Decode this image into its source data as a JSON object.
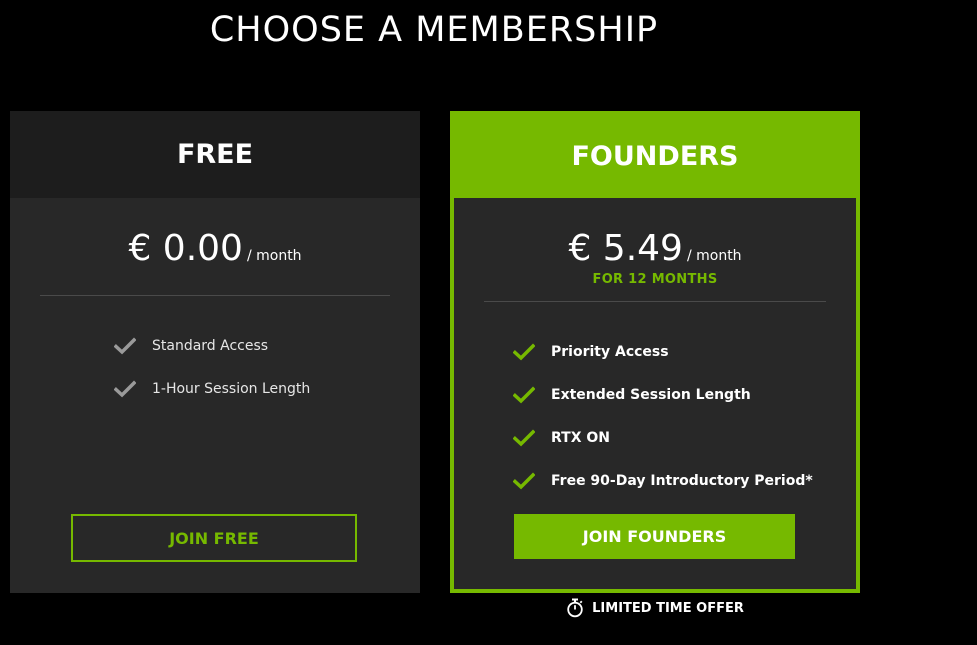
{
  "page": {
    "title": "CHOOSE A MEMBERSHIP"
  },
  "colors": {
    "accent": "#76b900",
    "card_background": "#282828",
    "free_header_background": "#1d1d1d",
    "page_background": "#000000",
    "free_check": "#9a9a9a"
  },
  "plans": {
    "free": {
      "name": "FREE",
      "price": "€ 0.00",
      "period": "/ month",
      "features": [
        {
          "label": "Standard Access",
          "icon": "check-icon"
        },
        {
          "label": "1-Hour Session Length",
          "icon": "check-icon"
        }
      ],
      "cta": "JOIN FREE"
    },
    "founders": {
      "name": "FOUNDERS",
      "price": "€ 5.49",
      "period": "/ month",
      "subnote": "FOR 12 MONTHS",
      "features": [
        {
          "label": "Priority Access",
          "icon": "check-icon"
        },
        {
          "label": "Extended Session Length",
          "icon": "check-icon"
        },
        {
          "label": "RTX ON",
          "icon": "check-icon"
        },
        {
          "label": "Free 90-Day Introductory Period*",
          "icon": "check-icon"
        }
      ],
      "cta": "JOIN FOUNDERS"
    }
  },
  "offer": {
    "label": "LIMITED TIME OFFER",
    "icon": "stopwatch-icon"
  }
}
